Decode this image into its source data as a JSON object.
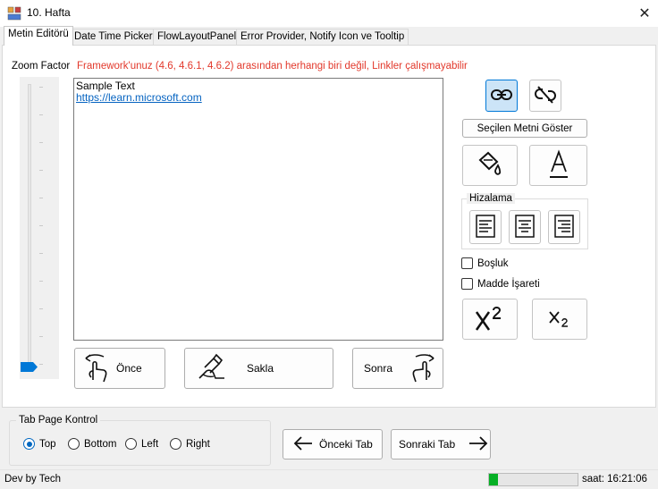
{
  "window": {
    "title": "10. Hafta",
    "close_glyph": "✕"
  },
  "tabs": [
    {
      "label": "Metin Editörü",
      "active": true
    },
    {
      "label": "Date Time Picker",
      "active": false
    },
    {
      "label": "FlowLayoutPanel",
      "active": false
    },
    {
      "label": "Error Provider, Notify Icon ve Tooltip",
      "active": false
    }
  ],
  "editor": {
    "zoom_label": "Zoom Factor",
    "warning": "Framework'unuz (4.6, 4.6.1, 4.6.2) arasından herhangi biri değil, Linkler çalışmayabilir",
    "zoom_level": 0.0,
    "text_line": "Sample Text",
    "link_text": "https://learn.microsoft.com"
  },
  "toolbar": {
    "show_selected": "Seçilen Metni Göster",
    "alignment_group": "Hizalama",
    "spacing_label": "Boşluk",
    "bullet_label": "Madde İşareti",
    "spacing_checked": false,
    "bullet_checked": false
  },
  "actions": {
    "undo_label": "Önce",
    "save_label": "Sakla",
    "redo_label": "Sonra"
  },
  "tab_control": {
    "group_title": "Tab Page Kontrol",
    "options": [
      "Top",
      "Bottom",
      "Left",
      "Right"
    ],
    "selected": "Top",
    "prev_label": "Önceki Tab",
    "next_label": "Sonraki Tab"
  },
  "status": {
    "left_text": "Dev by Tech",
    "progress": 0.1,
    "time_text": "saat: 16:21:06"
  },
  "colors": {
    "warning": "#e2382b",
    "link": "#0563c1",
    "accent": "#0078d7",
    "progress": "#06b025"
  },
  "icons": [
    "app-icon",
    "close-icon",
    "link-icon",
    "unlink-icon",
    "paint-bucket-icon",
    "font-color-icon",
    "align-left-icon",
    "align-center-icon",
    "align-right-icon",
    "superscript-icon",
    "subscript-icon",
    "swipe-left-hand-icon",
    "swipe-right-hand-icon",
    "sign-hand-icon",
    "arrow-left-icon",
    "arrow-right-icon"
  ]
}
